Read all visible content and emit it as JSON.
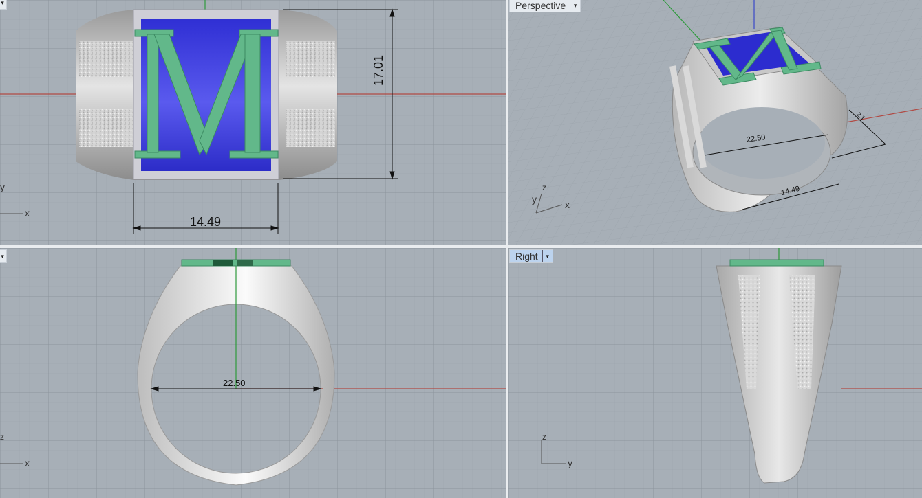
{
  "viewports": {
    "top": {
      "label": "",
      "dim_width": "14.49",
      "dim_height": "17.01",
      "axis_x": "x",
      "axis_y": "y"
    },
    "perspective": {
      "label": "Perspective",
      "dim_diameter": "22.50",
      "dim_width": "14.49",
      "dim_small": "2.1",
      "axis_x": "x",
      "axis_y": "y",
      "axis_z": "z"
    },
    "front": {
      "label": "",
      "dim_diameter": "22.50",
      "axis_x": "x",
      "axis_z": "z"
    },
    "right": {
      "label": "Right",
      "axis_y": "y",
      "axis_z": "z"
    }
  },
  "colors": {
    "grid_bg": "#a7afb7",
    "grid_line": "#9aa2aa",
    "x_axis": "#b14a44",
    "y_axis": "#2e9a3c",
    "z_axis": "#3a48c8",
    "metal": "#c8c8c8",
    "enamel_blue": "#3c3ce0",
    "letter_green": "#62b88a"
  },
  "ring": {
    "letter": "M"
  }
}
